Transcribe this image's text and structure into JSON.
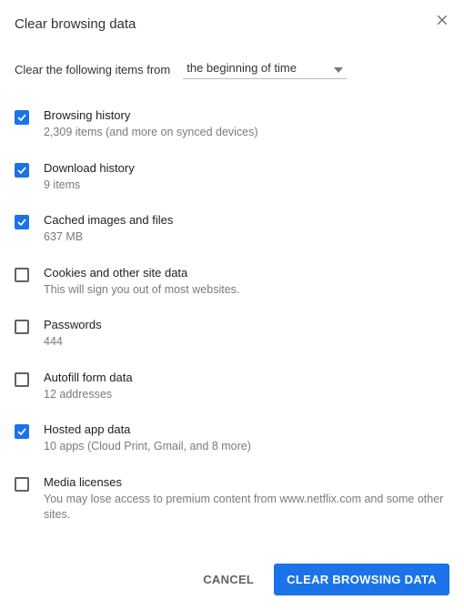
{
  "dialog": {
    "title": "Clear browsing data",
    "range_label": "Clear the following items from",
    "range_value": "the beginning of time"
  },
  "options": [
    {
      "label": "Browsing history",
      "desc": "2,309 items (and more on synced devices)",
      "checked": true
    },
    {
      "label": "Download history",
      "desc": "9 items",
      "checked": true
    },
    {
      "label": "Cached images and files",
      "desc": "637 MB",
      "checked": true
    },
    {
      "label": "Cookies and other site data",
      "desc": "This will sign you out of most websites.",
      "checked": false
    },
    {
      "label": "Passwords",
      "desc": "444",
      "checked": false
    },
    {
      "label": "Autofill form data",
      "desc": "12 addresses",
      "checked": false
    },
    {
      "label": "Hosted app data",
      "desc": "10 apps (Cloud Print, Gmail, and 8 more)",
      "checked": true
    },
    {
      "label": "Media licenses",
      "desc": "You may lose access to premium content from www.netflix.com and some other sites.",
      "checked": false
    }
  ],
  "actions": {
    "cancel": "Cancel",
    "confirm": "Clear browsing data"
  }
}
